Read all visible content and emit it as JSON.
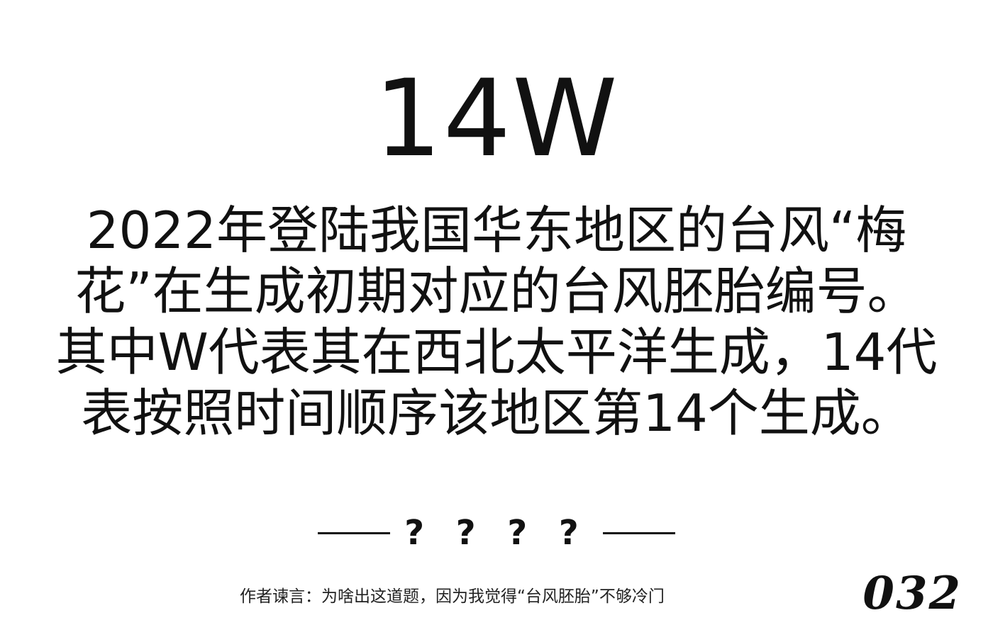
{
  "headline": "14W",
  "body_lines": [
    "2022年登陆我国华东地区的台风“梅",
    "花”在生成初期对应的台风胚胎编号。",
    "其中W代表其在西北太平洋生成，14代",
    "表按照时间顺序该地区第14个生成。"
  ],
  "answer": "? ? ? ?",
  "footnote": "作者谏言：为啥出这道题，因为我觉得“台风胚胎”不够冷门",
  "page_number": "032"
}
